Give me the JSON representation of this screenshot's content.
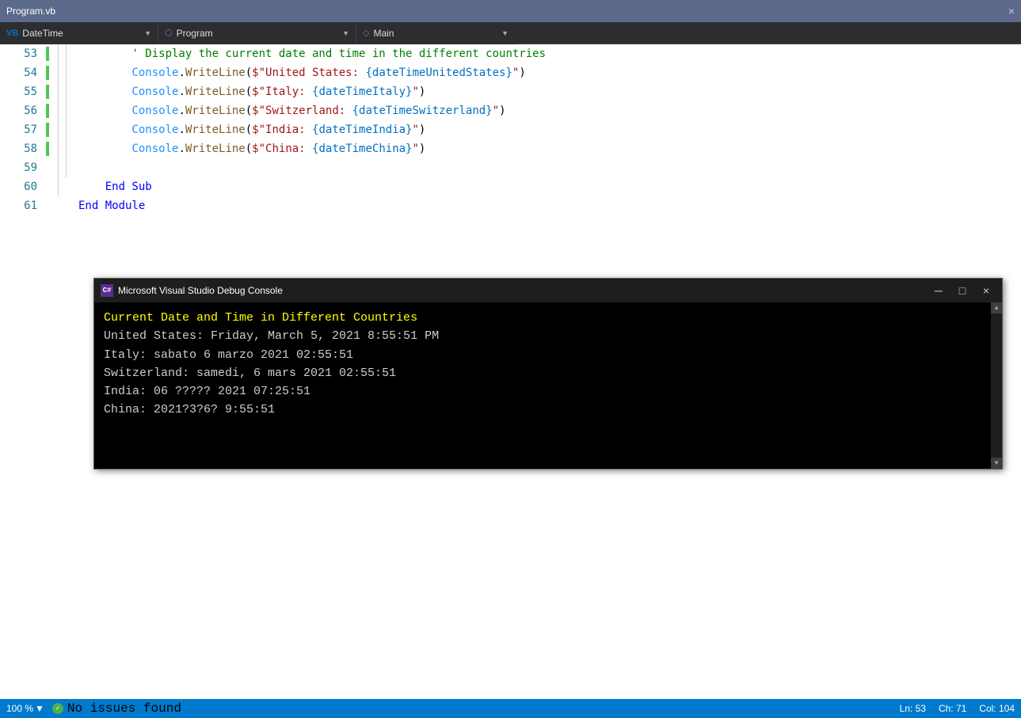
{
  "titleBar": {
    "filename": "Program.vb",
    "closeLabel": "×"
  },
  "navDropdowns": {
    "left": {
      "icon": "VB",
      "label": "DateTime",
      "arrow": "▼"
    },
    "middle": {
      "icon": "⬡",
      "label": "Program",
      "arrow": "▼"
    },
    "right": {
      "icon": "◇",
      "label": "Main",
      "arrow": "▼"
    }
  },
  "codeLines": [
    {
      "num": "53",
      "indent": 3,
      "content": "' Display the current date and time in the different countries",
      "type": "comment"
    },
    {
      "num": "54",
      "indent": 3,
      "content": "Console.WriteLine($\"United States: {dateTimeUnitedStates}\")",
      "type": "code"
    },
    {
      "num": "55",
      "indent": 3,
      "content": "Console.WriteLine($\"Italy: {dateTimeItaly}\")",
      "type": "code"
    },
    {
      "num": "56",
      "indent": 3,
      "content": "Console.WriteLine($\"Switzerland: {dateTimeSwitzerland}\")",
      "type": "code"
    },
    {
      "num": "57",
      "indent": 3,
      "content": "Console.WriteLine($\"India: {dateTimeIndia}\")",
      "type": "code"
    },
    {
      "num": "58",
      "indent": 3,
      "content": "Console.WriteLine($\"China: {dateTimeChina}\")",
      "type": "code"
    },
    {
      "num": "59",
      "indent": 0,
      "content": "",
      "type": "empty"
    },
    {
      "num": "60",
      "indent": 2,
      "content": "End Sub",
      "type": "keyword"
    },
    {
      "num": "61",
      "indent": 1,
      "content": "End Module",
      "type": "keyword"
    }
  ],
  "debugConsole": {
    "title": "Microsoft Visual Studio Debug Console",
    "icon": "C#",
    "lines": [
      {
        "text": "Current Date and Time in Different Countries",
        "type": "heading"
      },
      {
        "text": "United States: Friday, March 5, 2021  8:55:51 PM",
        "type": "normal"
      },
      {
        "text": "Italy: sabato 6 marzo 2021 02:55:51",
        "type": "normal"
      },
      {
        "text": "Switzerland: samedi, 6 mars 2021 02:55:51",
        "type": "normal"
      },
      {
        "text": "India: 06 ????? 2021 07:25:51",
        "type": "normal"
      },
      {
        "text": "China: 2021?3?6? 9:55:51",
        "type": "normal"
      }
    ],
    "buttons": {
      "minimize": "─",
      "maximize": "□",
      "close": "×"
    }
  },
  "statusBar": {
    "zoom": "100 %",
    "noIssues": "No issues found",
    "ln": "Ln: 53",
    "ch": "Ch: 71",
    "col": "Col: 104"
  }
}
